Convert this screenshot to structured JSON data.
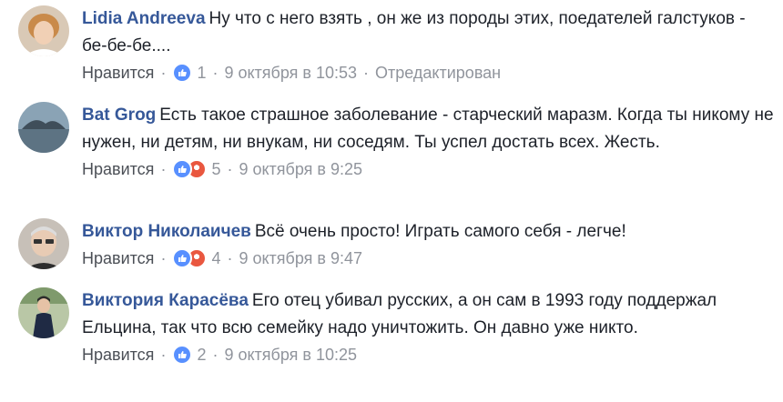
{
  "comments": [
    {
      "author": "Lidia Andreeva",
      "text": "Ну что с него взять , он же из породы этих, поедателей галстуков - бе-бе-бе....",
      "like_label": "Нравится",
      "reaction_count": "1",
      "timestamp": "9 октября в 10:53",
      "edited_label": "Отредактирован",
      "reactions": [
        "like-icon"
      ]
    },
    {
      "author": "Bat Grog",
      "text": "Есть такое страшное заболевание - старческий маразм. Когда ты никому не нужен, ни детям, ни внукам, ни соседям. Ты успел достать всех. Жесть.",
      "like_label": "Нравится",
      "reaction_count": "5",
      "timestamp": "9 октября в 9:25",
      "reactions": [
        "like-icon",
        "angry-icon"
      ]
    },
    {
      "author": "Виктор Николаичев",
      "text": "Всё очень просто! Играть самого себя - легче!",
      "like_label": "Нравится",
      "reaction_count": "4",
      "timestamp": "9 октября в 9:47",
      "reactions": [
        "like-icon",
        "angry-icon"
      ]
    },
    {
      "author": "Виктория Карасёва",
      "text": "Его отец убивал русских, а он сам в 1993 году поддержал Ельцина, так что всю семейку надо уничтожить. Он давно уже никто.",
      "like_label": "Нравится",
      "reaction_count": "2",
      "timestamp": "9 октября в 10:25",
      "reactions": [
        "like-icon"
      ]
    }
  ],
  "colors": {
    "author": "#365899",
    "meta": "#90949c",
    "like_reaction": "#5890ff",
    "angry_reaction": "#e9573f"
  }
}
